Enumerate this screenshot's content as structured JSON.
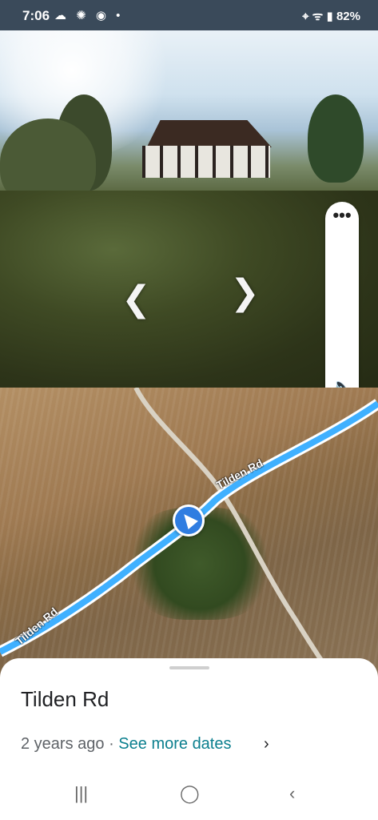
{
  "status_bar": {
    "time": "7:06",
    "left_icons": "☁ ✺ ◉ •",
    "right_text": "82%",
    "right_icons": "⌖ ᯤ ▮"
  },
  "street_view": {
    "prev_arrow": "❮",
    "next_arrow": "❯",
    "more_button": "•••",
    "sound_icon": "🔈"
  },
  "map": {
    "road_label_top": "Tilden Rd",
    "road_label_bottom": "Tilden Rd",
    "route_color": "#3fb0ff"
  },
  "sheet": {
    "title": "Tilden Rd",
    "date_text": "2 years ago",
    "separator": " · ",
    "link_text": "See more dates",
    "chevron": "›"
  },
  "nav": {
    "recents": "|||",
    "home": "◯",
    "back": "‹"
  }
}
